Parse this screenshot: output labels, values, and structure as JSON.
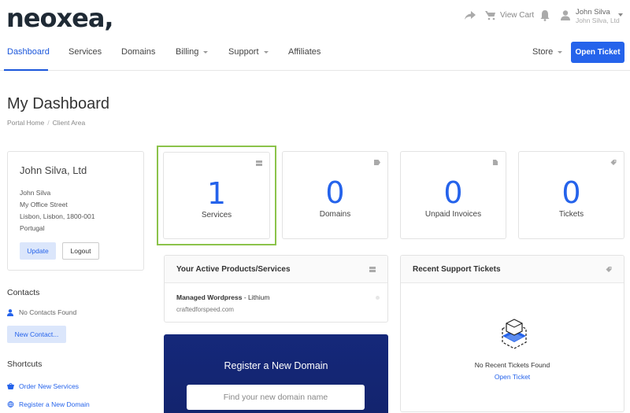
{
  "brand": {
    "logo_text": "neoxea",
    "accent": "#2563eb",
    "highlight_border": "#8bc34a"
  },
  "topbar": {
    "view_cart": "View Cart",
    "user_name": "John Silva",
    "user_company": "John Silva, Ltd"
  },
  "nav": {
    "items": [
      {
        "label": "Dashboard",
        "active": true
      },
      {
        "label": "Services"
      },
      {
        "label": "Domains"
      },
      {
        "label": "Billing",
        "dropdown": true
      },
      {
        "label": "Support",
        "dropdown": true
      },
      {
        "label": "Affiliates"
      }
    ],
    "store": "Store",
    "open_ticket": "Open Ticket"
  },
  "page": {
    "title": "My Dashboard",
    "breadcrumb": [
      "Portal Home",
      "Client Area"
    ]
  },
  "profile": {
    "company": "John Silva, Ltd",
    "address": [
      "John Silva",
      "My Office Street",
      "Lisbon, Lisbon, 1800-001",
      "Portugal"
    ],
    "update_label": "Update",
    "logout_label": "Logout"
  },
  "contacts": {
    "title": "Contacts",
    "empty": "No Contacts Found",
    "new_contact": "New Contact..."
  },
  "shortcuts": {
    "title": "Shortcuts",
    "items": [
      "Order New Services",
      "Register a New Domain"
    ]
  },
  "stats": [
    {
      "value": "1",
      "label": "Services",
      "icon": "server-icon"
    },
    {
      "value": "0",
      "label": "Domains",
      "icon": "tag-icon"
    },
    {
      "value": "0",
      "label": "Unpaid Invoices",
      "icon": "document-icon"
    },
    {
      "value": "0",
      "label": "Tickets",
      "icon": "ticket-icon"
    }
  ],
  "active_products": {
    "title": "Your Active Products/Services",
    "product": "Managed Wordpress",
    "product_group": "Lithium",
    "domain": "craftedforspeed.com"
  },
  "support_tickets": {
    "title": "Recent Support Tickets",
    "empty": "No Recent Tickets Found",
    "open_ticket": "Open Ticket"
  },
  "register_domain": {
    "title": "Register a New Domain",
    "placeholder": "Find your new domain name"
  }
}
